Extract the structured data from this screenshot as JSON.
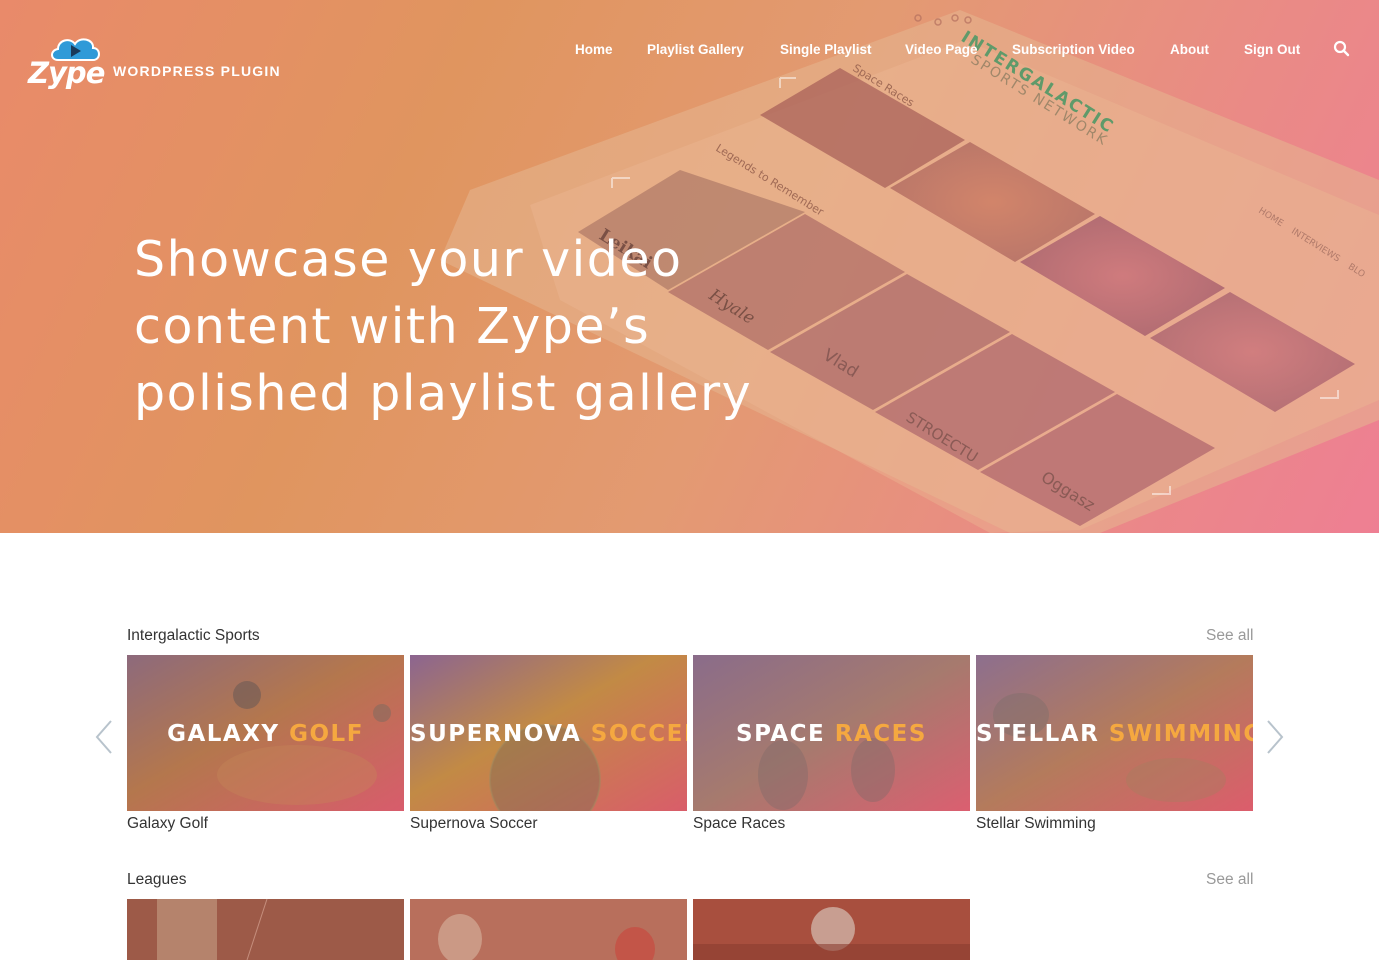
{
  "brand": {
    "logo_text": "Zype",
    "subtitle": "WORDPRESS PLUGIN"
  },
  "nav": {
    "items": [
      "Home",
      "Playlist Gallery",
      "Single Playlist",
      "Video Page",
      "Subscription Video",
      "About",
      "Sign Out"
    ],
    "search_icon": "search-icon"
  },
  "hero": {
    "headline_lines": [
      "Showcase your video",
      "content with Zype’s",
      "polished playlist gallery"
    ],
    "device_text": {
      "network_title": "INTERGALACTIC",
      "network_sub": "SPORTS NETWORK",
      "row1": "Space Races",
      "row2": "Legends to Remember",
      "menu": "HOME    INTERVIEWS    BLO",
      "tiles": [
        "Leikai",
        "Hyale",
        "Vlad",
        "STROECTU",
        "Oggasz"
      ]
    }
  },
  "colors": {
    "accent": "#f5a840",
    "hero_gradient_start": "#e98a6a",
    "hero_gradient_end": "#ee7f93"
  },
  "sections": [
    {
      "title": "Intergalactic Sports",
      "see_all": "See all",
      "cards": [
        {
          "overlay_main": "GALAXY",
          "overlay_accent": "GOLF",
          "caption": "Galaxy Golf"
        },
        {
          "overlay_main": "SUPERNOVA",
          "overlay_accent": "SOCCER",
          "caption": "Supernova Soccer"
        },
        {
          "overlay_main": "SPACE",
          "overlay_accent": "RACES",
          "caption": "Space Races"
        },
        {
          "overlay_main": "STELLAR",
          "overlay_accent": "SWIMMING",
          "caption": "Stellar Swimming"
        }
      ],
      "prev_icon": "chevron-left-icon",
      "next_icon": "chevron-right-icon"
    },
    {
      "title": "Leagues",
      "see_all": "See all",
      "cards": [
        {},
        {},
        {}
      ]
    }
  ]
}
